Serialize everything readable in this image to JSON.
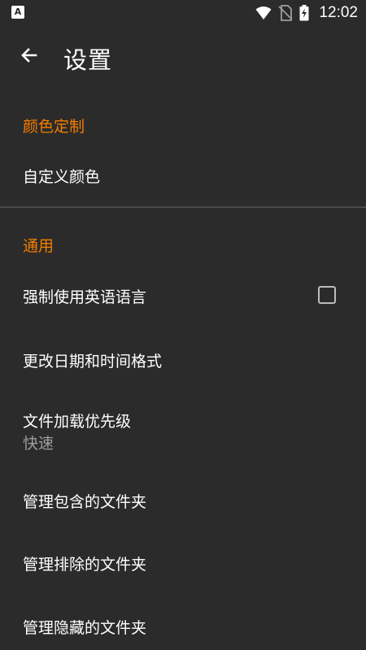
{
  "status_bar": {
    "time": "12:02",
    "left_icon": "A",
    "icons": [
      "wifi-icon",
      "no-sim-icon",
      "battery-charging-icon"
    ]
  },
  "app_bar": {
    "title": "设置",
    "back_icon": "arrow-left-icon"
  },
  "sections": [
    {
      "header": "颜色定制",
      "items": [
        {
          "title": "自定义颜色"
        }
      ]
    },
    {
      "header": "通用",
      "items": [
        {
          "title": "强制使用英语语言",
          "checkbox": false
        },
        {
          "title": "更改日期和时间格式"
        },
        {
          "title": "文件加载优先级",
          "summary": "快速"
        },
        {
          "title": "管理包含的文件夹"
        },
        {
          "title": "管理排除的文件夹"
        },
        {
          "title": "管理隐藏的文件夹"
        }
      ]
    }
  ],
  "colors": {
    "background": "#2b2b2b",
    "accent": "#f57c00",
    "text_primary": "#ffffff",
    "text_secondary": "#9e9e9e"
  }
}
